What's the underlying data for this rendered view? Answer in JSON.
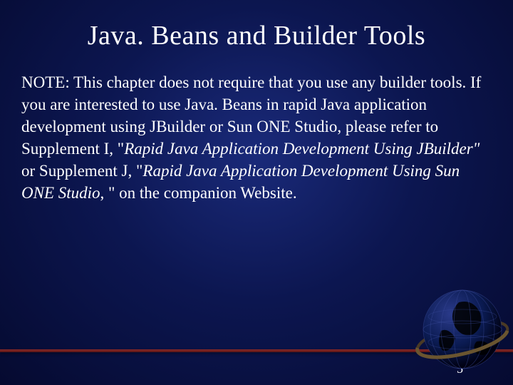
{
  "title": "Java. Beans and Builder Tools",
  "body": {
    "p1": "NOTE: This chapter does not require that you use any builder tools. If you are interested to use Java. Beans in rapid Java application development using JBuilder or Sun ONE Studio, please refer to Supplement I, \"",
    "i1": "Rapid Java Application Development Using JBuilder\"",
    "p2": " or Supplement J, \"",
    "i2": "Rapid Java Application Development Using Sun ONE Studio",
    "p3": ", \" on the companion Website."
  },
  "page_number": "5"
}
